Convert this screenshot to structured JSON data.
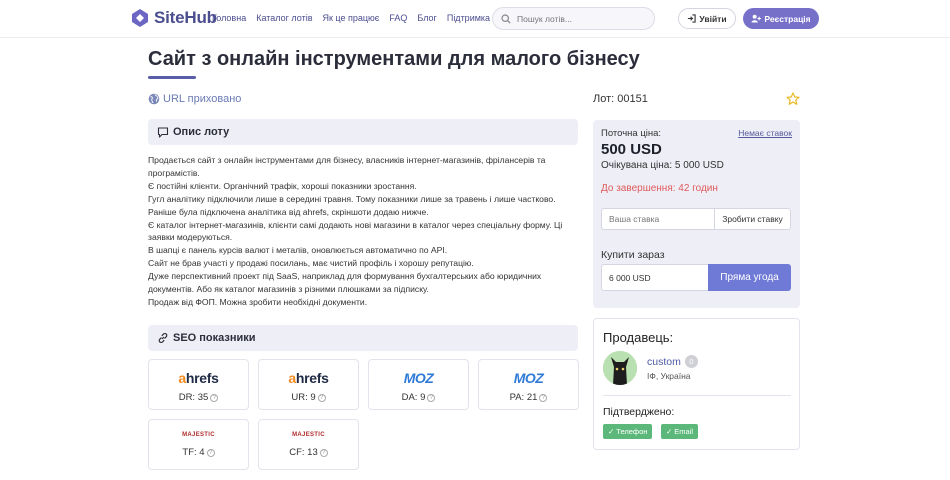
{
  "header": {
    "logo_text": "SiteHub",
    "nav": [
      "Головна",
      "Каталог лотів",
      "Як це працює",
      "FAQ",
      "Блог",
      "Підтримка"
    ],
    "search_placeholder": "Пошук лотів...",
    "login_label": "Увійти",
    "register_label": "Реєстрація"
  },
  "page": {
    "title": "Сайт з онлайн інструментами для малого бізнесу",
    "url_hidden": "URL приховано",
    "lot_number": "Лот: 00151"
  },
  "description": {
    "heading": "Опис лоту",
    "lines": [
      "Продається сайт з онлайн інструментами для бізнесу, власників інтернет-магазинів, фрілансерів та програмістів.",
      "Є постійні клієнти. Органічний трафік, хороші показники зростання.",
      "Гугл аналітику підключили лише в середині травня. Тому показники лише за травень і лише частково. Раніше була підключена аналітика від ahrefs, скріншоти додаю нижче.",
      "Є каталог інтернет-магазинів, клієнти самі додають нові магазини в каталог через спеціальну форму. Ці заявки модеруються.",
      "В шапці є панель курсів валют і металів, оновлюється автоматично по API.",
      "Сайт не брав участі у продажі посилань, має чистий профіль і хорошу репутацію.",
      "Дуже перспективний проект під SaaS, наприклад для формування бухгалтерських або юридичних документів. Або як каталог магазинів з різними плюшками за підписку.",
      "Продаж від ФОП. Можна зробити необхідні документи."
    ]
  },
  "seo": {
    "heading": "SEO показники",
    "metrics": [
      {
        "brand": "ahrefs",
        "label": "DR: 35"
      },
      {
        "brand": "ahrefs",
        "label": "UR: 9"
      },
      {
        "brand": "MOZ",
        "label": "DA: 9"
      },
      {
        "brand": "MOZ",
        "label": "PA: 21"
      },
      {
        "brand": "MAJESTIC",
        "label": "TF: 4"
      },
      {
        "brand": "MAJESTIC",
        "label": "CF: 13"
      }
    ]
  },
  "price": {
    "current_label": "Поточна ціна:",
    "no_bids": "Немає ставок",
    "current_value": "500 USD",
    "expected": "Очікувана ціна: 5 000 USD",
    "ends": "До завершення: 42 годин",
    "bid_placeholder": "Ваша ставка",
    "bid_button": "Зробити ставку",
    "buy_label": "Купити зараз",
    "buy_value": "6 000 USD",
    "buy_button": "Пряма угода"
  },
  "seller": {
    "title": "Продавець:",
    "name": "custom",
    "badge": "0",
    "location": "ІФ, Україна",
    "verified_label": "Підтверджено:",
    "verified": [
      "Телефон",
      "Email"
    ]
  },
  "colors": {
    "accent": "#7670c9",
    "brand": "#4b4e8f",
    "danger": "#e05a5a",
    "success": "#5cb87a"
  }
}
